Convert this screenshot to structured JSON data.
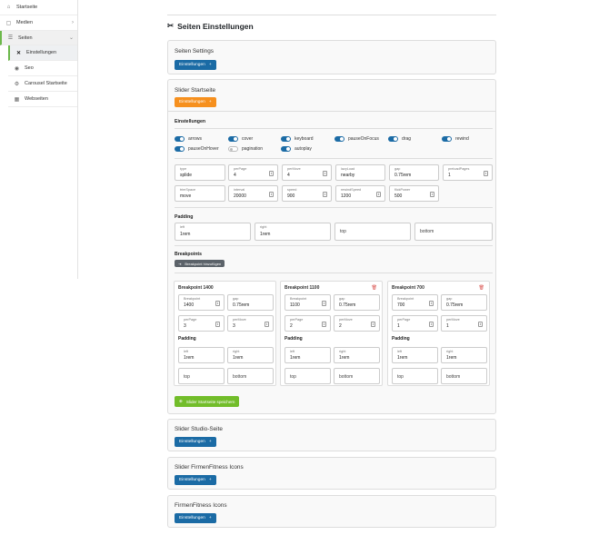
{
  "sidebar": {
    "items": [
      {
        "icon": "home-icon",
        "glyph": "⌂",
        "label": "Startseite"
      },
      {
        "icon": "media-icon",
        "glyph": "▢",
        "label": "Medien"
      },
      {
        "icon": "pages-icon",
        "glyph": "☰",
        "label": "Seiten"
      },
      {
        "icon": "tools-icon",
        "glyph": "✕",
        "label": "Einstellungen"
      },
      {
        "icon": "seo-icon",
        "glyph": "◉",
        "label": "Seo"
      },
      {
        "icon": "carousel-icon",
        "glyph": "⚙",
        "label": "Carousel Startseite"
      },
      {
        "icon": "websites-icon",
        "glyph": "▦",
        "label": "Webseiten"
      }
    ]
  },
  "page": {
    "title": "Seiten Einstellungen"
  },
  "cards": {
    "seiten_settings": {
      "title": "Seiten Settings",
      "button": "Einstellungen"
    },
    "slider_startseite": {
      "title": "Slider Startseite",
      "button": "Einstellungen"
    },
    "slider_studio": {
      "title": "Slider Studio-Seite",
      "button": "Einstellungen"
    },
    "slider_firmen": {
      "title": "Slider FirmenFitness Icons",
      "button": "Einstellungen"
    },
    "firmen_icons": {
      "title": "FirmenFitness Icons",
      "button": "Einstellungen"
    }
  },
  "settings": {
    "heading": "Einstellungen",
    "toggles": [
      {
        "label": "arrows",
        "on": true
      },
      {
        "label": "cover",
        "on": true
      },
      {
        "label": "keyboard",
        "on": true
      },
      {
        "label": "pauseOnFocus",
        "on": true
      },
      {
        "label": "drag",
        "on": true
      },
      {
        "label": "rewind",
        "on": true
      },
      {
        "label": "pauseOnHover",
        "on": true
      },
      {
        "label": "pagination",
        "on": false
      },
      {
        "label": "autoplay",
        "on": true
      }
    ],
    "fields": [
      {
        "label": "type",
        "value": "splide"
      },
      {
        "label": "perPage",
        "value": "4"
      },
      {
        "label": "perMove",
        "value": "4"
      },
      {
        "label": "lazyLoad",
        "value": "nearby"
      },
      {
        "label": "gap",
        "value": "0.75rem"
      },
      {
        "label": "preloadPages",
        "value": "1"
      },
      {
        "label": "trimSpace",
        "value": "move"
      },
      {
        "label": "interval",
        "value": "20000"
      },
      {
        "label": "speed",
        "value": "900"
      },
      {
        "label": "rewindSpeed",
        "value": "1200"
      },
      {
        "label": "flickPower",
        "value": "500"
      }
    ],
    "padding_heading": "Padding",
    "padding": [
      {
        "label": "left",
        "value": "1rem"
      },
      {
        "label": "right",
        "value": "1rem"
      },
      {
        "label": "",
        "value": "top"
      },
      {
        "label": "",
        "value": "bottom"
      }
    ],
    "breakpoints_heading": "Breakpoints",
    "add_breakpoint": "Breakpoint hinzufügen",
    "save": "Slider Startseite speichern"
  },
  "breakpoints": [
    {
      "title": "Breakpoint 1400",
      "deletable": false,
      "breakpoint": "1400",
      "gap": "0.75rem",
      "perPage": "3",
      "perMove": "3",
      "left": "1rem",
      "right": "1rem"
    },
    {
      "title": "Breakpoint 1100",
      "deletable": true,
      "breakpoint": "1100",
      "gap": "0.75rem",
      "perPage": "2",
      "perMove": "2",
      "left": "1rem",
      "right": "1rem"
    },
    {
      "title": "Breakpoint 700",
      "deletable": true,
      "breakpoint": "700",
      "gap": "0.75rem",
      "perPage": "1",
      "perMove": "1",
      "left": "1rem",
      "right": "1rem"
    }
  ],
  "bp_labels": {
    "breakpoint": "Breakpoint",
    "gap": "gap",
    "perPage": "perPage",
    "perMove": "perMove",
    "padding": "Padding",
    "left": "left",
    "right": "right",
    "top": "top",
    "bottom": "bottom"
  }
}
